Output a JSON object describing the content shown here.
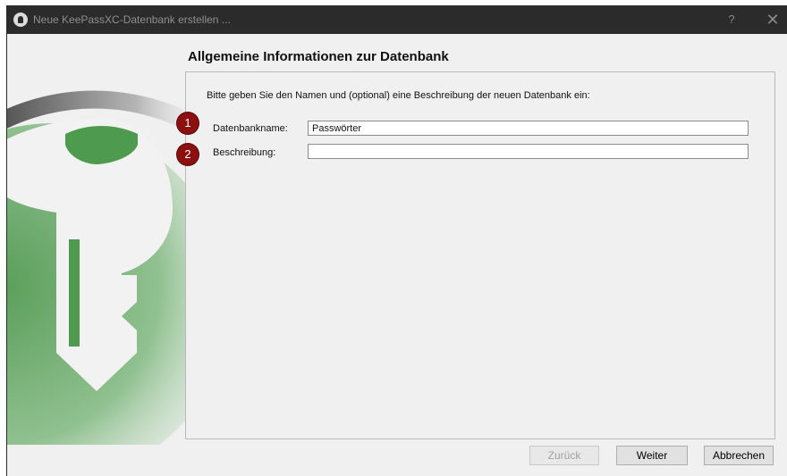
{
  "window": {
    "title": "Neue KeePassXC-Datenbank erstellen ...",
    "help_label": "?",
    "close_label": "✕"
  },
  "page": {
    "heading": "Allgemeine Informationen zur Datenbank",
    "intro": "Bitte geben Sie den Namen und (optional) eine Beschreibung der neuen Datenbank ein:"
  },
  "form": {
    "name_label": "Datenbankname:",
    "name_value": "Passwörter",
    "description_label": "Beschreibung:",
    "description_value": ""
  },
  "annotations": {
    "badge_1": "1",
    "badge_2": "2",
    "badge_color": "#8c1010"
  },
  "buttons": {
    "back_label": "Zurück",
    "next_label": "Weiter",
    "cancel_label": "Abbrechen"
  },
  "colors": {
    "titlebar": "#2b2b2b",
    "key_green": "#4e9a4e"
  }
}
